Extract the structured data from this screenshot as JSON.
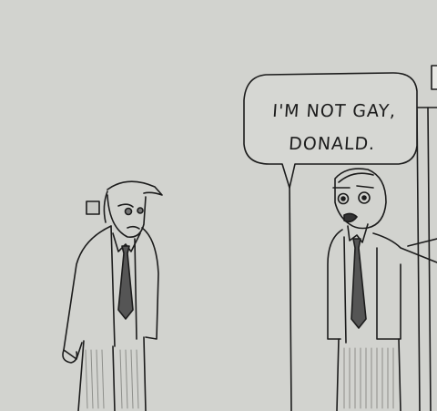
{
  "speech_bubble": {
    "line1": "I'M NOT GAY,",
    "line2": "DONALD."
  },
  "colors": {
    "paper": "#d2d3cf",
    "ink": "#1c1c1c",
    "shade": "#a9aaa6"
  }
}
